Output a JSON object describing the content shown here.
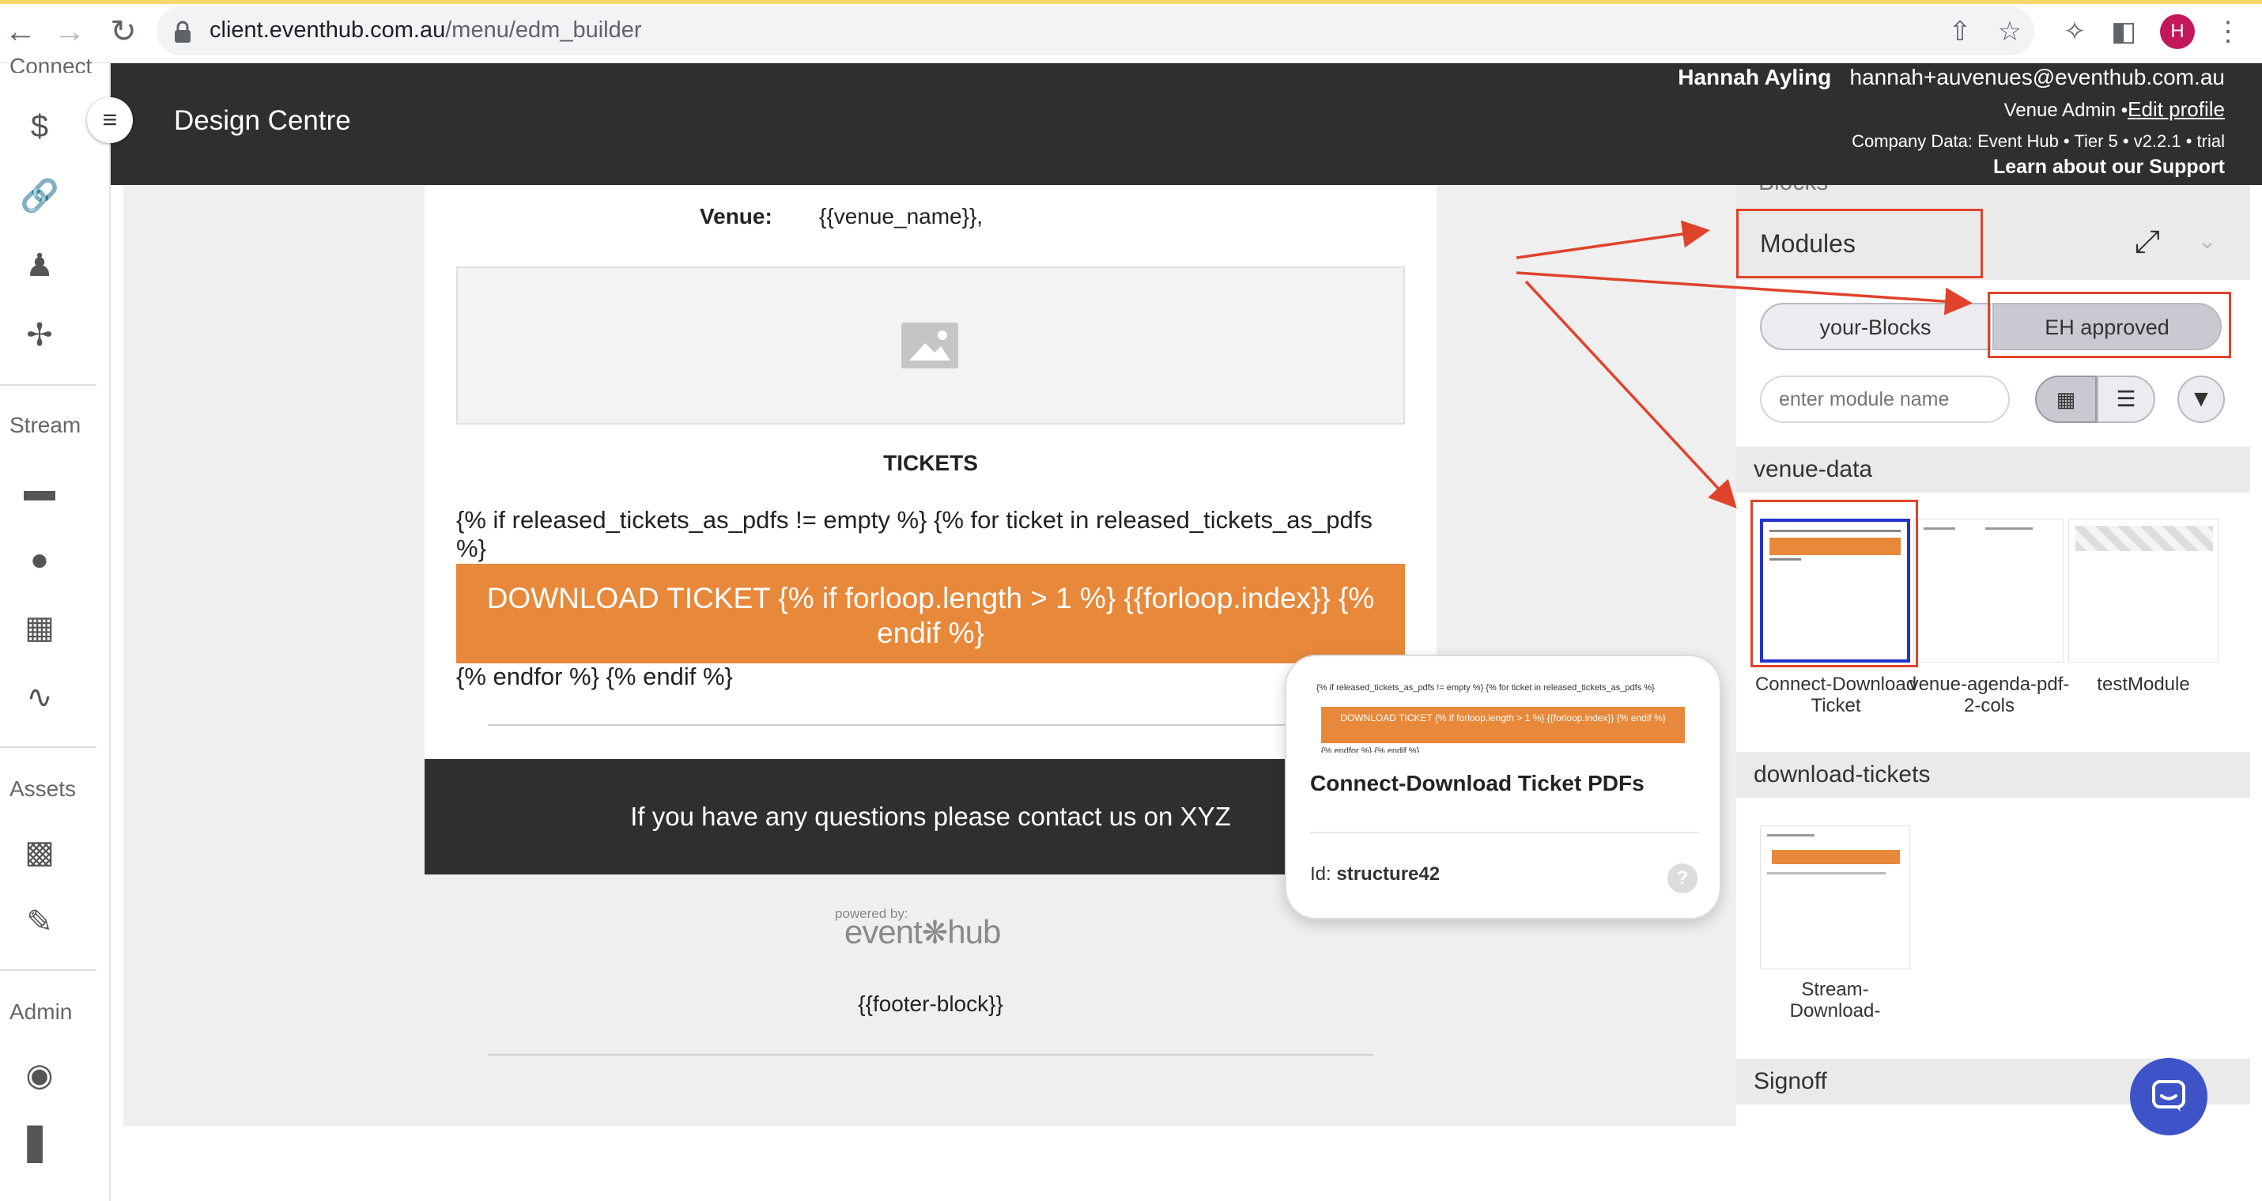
{
  "browser": {
    "url_host": "client.eventhub.com.au",
    "url_path": "/menu/edm_builder",
    "profile_initial": "H"
  },
  "sidebar": {
    "top_partial": "Connect",
    "sections": [
      "Stream",
      "Assets",
      "Admin"
    ],
    "icons": [
      "dollar-icon",
      "link-icon",
      "people-icon",
      "cutlery-icon",
      "list-icon",
      "person-icon",
      "calendar-icon",
      "trend-icon",
      "building-icon",
      "pencil-icon",
      "account-icon",
      "bar-chart-icon"
    ]
  },
  "header": {
    "title": "Design Centre",
    "user_name": "Hannah Ayling",
    "user_email": "hannah+auvenues@eventhub.com.au",
    "role": "Venue Admin •",
    "edit_profile": "Edit profile",
    "company": "Company Data: Event Hub • Tier 5 • v2.2.1 • trial",
    "support": "Learn about our Support"
  },
  "email": {
    "venue_label": "Venue:",
    "venue_value": "{{venue_name}},",
    "tickets_heading": "TICKETS",
    "if_line": "{% if released_tickets_as_pdfs != empty %} {% for ticket in released_tickets_as_pdfs",
    "if_line_end": "%}",
    "download_button": "DOWNLOAD TICKET {% if forloop.length > 1 %} {{forloop.index}} {% endif %}",
    "endfor_line": "{% endfor %} {% endif %}",
    "contact_text": "If you have any questions please contact us on XYZ",
    "powered_by": "powered by:",
    "logo_text_1": "event",
    "logo_text_2": "hub",
    "footer_block": "{{footer-block}}"
  },
  "tooltip": {
    "preview_text": "{% if released_tickets_as_pdfs != empty %} {% for ticket in released_tickets_as_pdfs %}",
    "preview_button": "DOWNLOAD TICKET {% if forloop.length > 1 %} {{forloop.index}} {% endif %}",
    "preview_tail": "{% endfor %} {% endif %}",
    "title": "Connect-Download Ticket PDFs",
    "id_label": "Id:",
    "id_value": "structure42",
    "help": "?"
  },
  "panel": {
    "blocks_partial": "Blocks",
    "modules_title": "Modules",
    "toggle_left": "your-Blocks",
    "toggle_right": "EH approved",
    "search_placeholder": "enter module name",
    "groups": [
      {
        "title": "venue-data",
        "modules": [
          {
            "label": "Connect-Download Ticket",
            "selected": true
          },
          {
            "label": "venue-agenda-pdf-2-cols",
            "selected": false
          },
          {
            "label": "testModule",
            "selected": false
          }
        ]
      },
      {
        "title": "download-tickets",
        "modules": [
          {
            "label": "Stream-Download-",
            "selected": false
          }
        ]
      }
    ],
    "signoff_title": "Signoff"
  },
  "colors": {
    "header_bg": "#2f2f2f",
    "download_orange": "#e8883a",
    "annotation_red": "#e0432b",
    "selected_blue": "#2233cc",
    "chat_blue": "#3d53c7"
  }
}
